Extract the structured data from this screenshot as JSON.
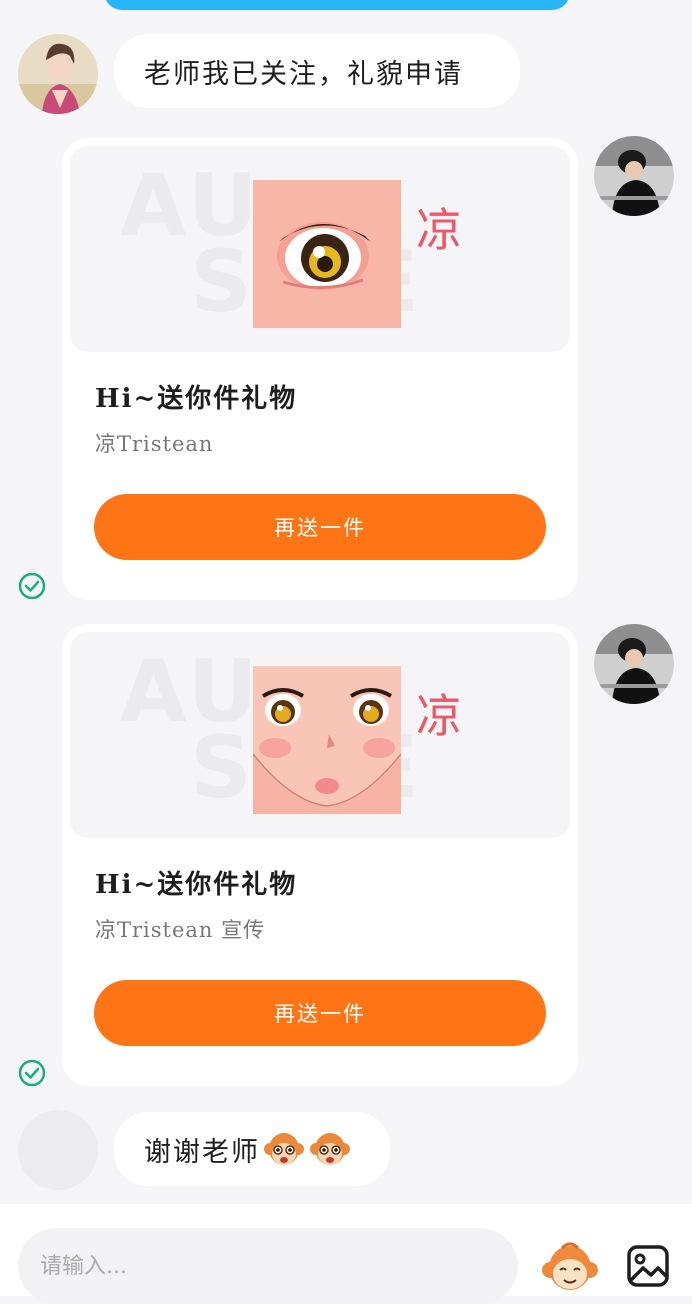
{
  "messages": [
    {
      "side": "left",
      "text": "老师我已关注，礼貌申请"
    },
    {
      "side": "right",
      "type": "gift",
      "title": "Hi~送你件礼物",
      "subtitle": "凉Tristean",
      "button": "再送一件",
      "char": "凉",
      "watermark": [
        "AU",
        "S  RE"
      ]
    },
    {
      "side": "right",
      "type": "gift",
      "title": "Hi~送你件礼物",
      "subtitle": "凉Tristean 宣传",
      "button": "再送一件",
      "char": "凉",
      "watermark": [
        "AU",
        "S  RE"
      ]
    },
    {
      "side": "left",
      "text": "谢谢老师"
    }
  ],
  "input": {
    "placeholder": "请输入..."
  },
  "icons": {
    "emoji": "monkey-sticker-icon",
    "image": "image-icon",
    "sent_status": "check-circle-icon"
  },
  "colors": {
    "accent": "#ff7415",
    "check": "#1aad7a",
    "top_bar": "#29b6f6",
    "gift_char": "#e85a6a"
  }
}
